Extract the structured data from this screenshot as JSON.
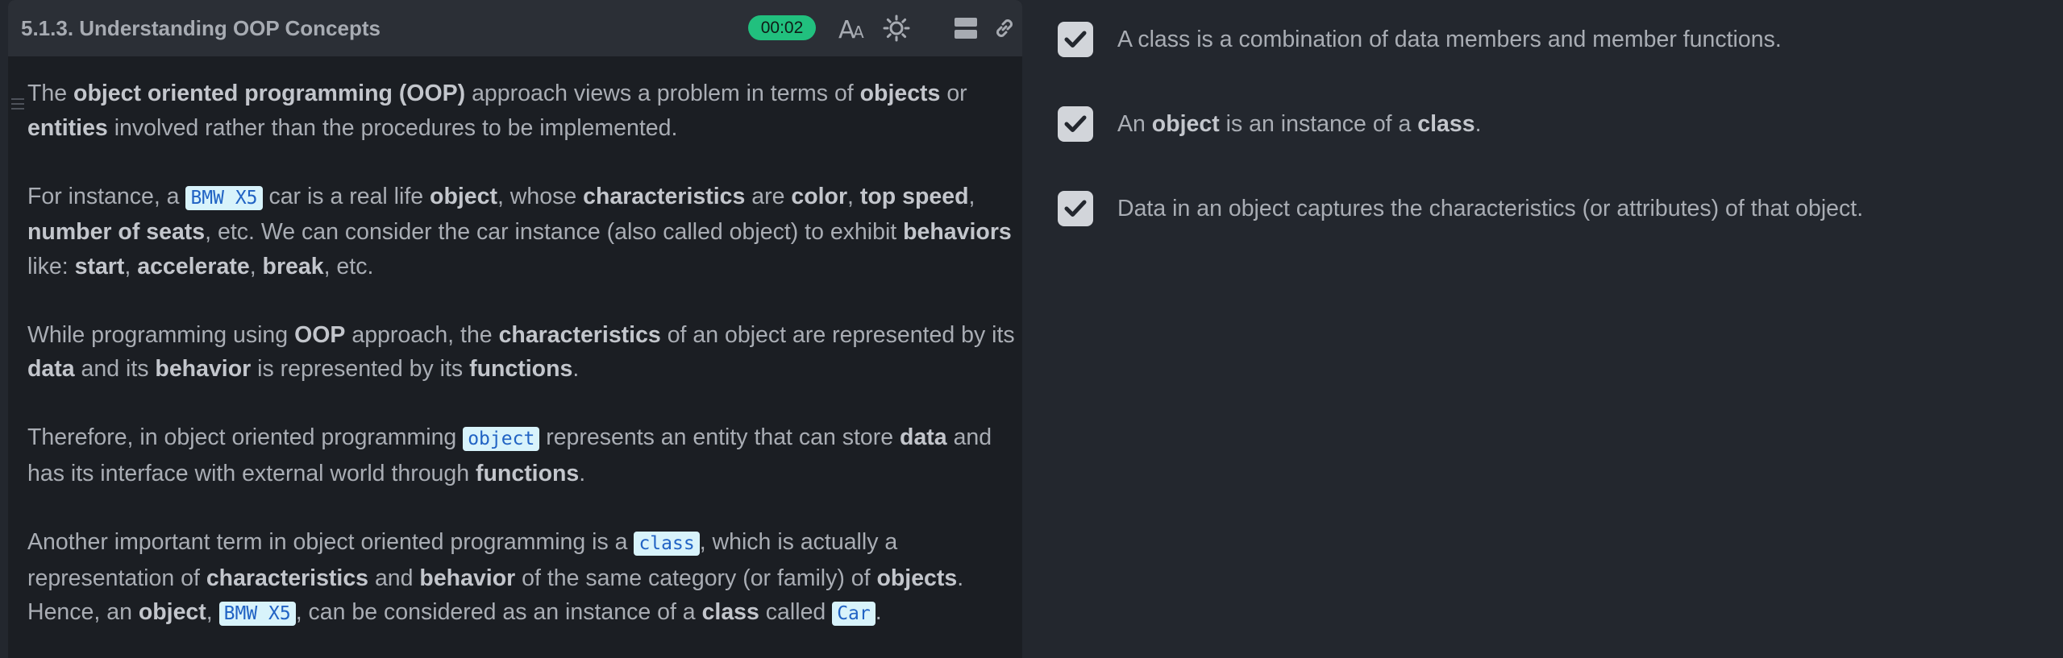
{
  "header": {
    "title": "5.1.3. Understanding OOP Concepts",
    "timer": "00:02",
    "icons": [
      "font-size-icon",
      "theme-sun-icon",
      "layout-split-icon",
      "link-icon"
    ]
  },
  "content": {
    "p1": {
      "t1": "The ",
      "b1": "object oriented programming (OOP)",
      "t2": " approach views a problem in terms of ",
      "b2": "objects",
      "t3": " or ",
      "b3": "entities",
      "t4": " involved rather than the procedures to be implemented."
    },
    "p2": {
      "t1": "For instance, a ",
      "c1": "BMW X5",
      "t2": " car is a real life ",
      "b1": "object",
      "t3": ", whose ",
      "b2": "characteristics",
      "t4": " are ",
      "b3": "color",
      "t5": ", ",
      "b4": "top speed",
      "t6": ", ",
      "b5": "number of seats",
      "t7": ", etc. We can consider the car instance (also called object) to exhibit ",
      "b6": "behaviors",
      "t8": " like: ",
      "b7": "start",
      "t9": ", ",
      "b8": "accelerate",
      "t10": ", ",
      "b9": "break",
      "t11": ", etc."
    },
    "p3": {
      "t1": "While programming using ",
      "b1": "OOP",
      "t2": " approach, the ",
      "b2": "characteristics",
      "t3": " of an object are represented by its ",
      "b3": "data",
      "t4": " and its ",
      "b4": "behavior",
      "t5": " is represented by its ",
      "b5": "functions",
      "t6": "."
    },
    "p4": {
      "t1": "Therefore, in object oriented programming ",
      "c1": "object",
      "t2": " represents an entity that can store ",
      "b1": "data",
      "t3": " and has its interface with external world through ",
      "b2": "functions",
      "t4": "."
    },
    "p5": {
      "t1": "Another important term in object oriented programming is a ",
      "c1": "class",
      "t2": ", which is actually a representation of ",
      "b1": "characteristics",
      "t3": " and ",
      "b2": "behavior",
      "t4": " of the same category (or family) of ",
      "b3": "objects",
      "t5": ". Hence, an ",
      "b4": "object",
      "t6": ", ",
      "c2": "BMW X5",
      "t7": ", can be considered as an instance of a ",
      "b5": "class",
      "t8": " called ",
      "c3": "Car",
      "t9": "."
    }
  },
  "checklist": {
    "item1": {
      "text": "A class is a combination of data members and member functions.",
      "checked": true
    },
    "item2": {
      "t1": "An ",
      "b1": "object",
      "t2": " is an instance of a ",
      "b2": "class",
      "t3": ".",
      "checked": true
    },
    "item3": {
      "text": "Data in an object captures the characteristics (or attributes) of that object.",
      "checked": true
    }
  },
  "colors": {
    "timer_badge": "#21c07e",
    "checkbox": "#d2d5da",
    "code_bg": "#d8f3fb",
    "code_text": "#2163c4"
  }
}
